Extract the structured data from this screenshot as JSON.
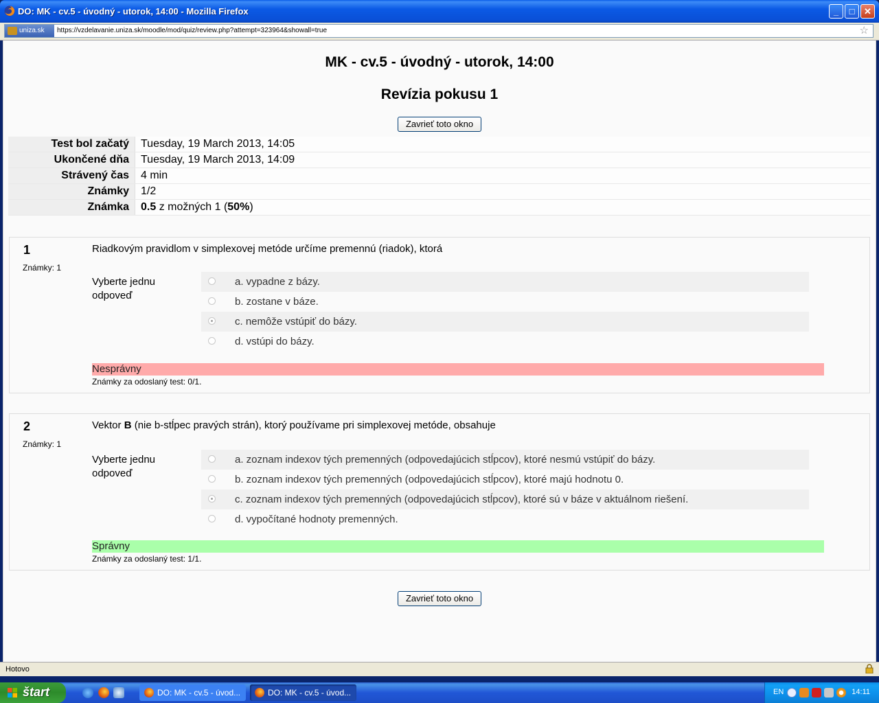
{
  "window": {
    "title": "DO: MK - cv.5 - úvodný - utorok, 14:00 - Mozilla Firefox"
  },
  "addressbar": {
    "site_identity": "uniza.sk",
    "url": "https://vzdelavanie.uniza.sk/moodle/mod/quiz/review.php?attempt=323964&showall=true"
  },
  "page": {
    "title": "MK - cv.5 - úvodný - utorok, 14:00",
    "subtitle": "Revízia pokusu 1",
    "close_button": "Zavrieť toto okno"
  },
  "summary": {
    "rows": [
      {
        "label": "Test bol začatý",
        "value": "Tuesday, 19 March 2013, 14:05"
      },
      {
        "label": "Ukončené dňa",
        "value": "Tuesday, 19 March 2013, 14:09"
      },
      {
        "label": "Strávený čas",
        "value": "4 min"
      },
      {
        "label": "Známky",
        "value": "1/2"
      },
      {
        "label": "Známka",
        "value_bold": "0.5",
        "value_mid": " z možných 1 (",
        "value_pct": "50%",
        "value_end": ")"
      }
    ]
  },
  "questions": [
    {
      "number": "1",
      "marks": "Známky: 1",
      "text": "Riadkovým pravidlom v simplexovej metóde určíme premennú (riadok), ktorá",
      "prompt": "Vyberte jednu odpoveď",
      "answers": [
        {
          "label": "a. vypadne z bázy.",
          "checked": false
        },
        {
          "label": "b. zostane v báze.",
          "checked": false
        },
        {
          "label": "c. nemôže vstúpiť do bázy.",
          "checked": true
        },
        {
          "label": "d. vstúpi do bázy.",
          "checked": false
        }
      ],
      "result": "Nesprávny",
      "result_marks": "Známky za odoslaný test: 0/1."
    },
    {
      "number": "2",
      "marks": "Známky: 1",
      "text_pre": "Vektor ",
      "text_bold": "B",
      "text_post": " (nie b-stĺpec pravých strán), ktorý používame pri simplexovej metóde, obsahuje",
      "prompt": "Vyberte jednu odpoveď",
      "answers": [
        {
          "label": "a. zoznam indexov tých premenných (odpovedajúcich stĺpcov), ktoré nesmú vstúpiť do bázy.",
          "checked": false
        },
        {
          "label": "b. zoznam indexov tých premenných (odpovedajúcich stĺpcov), ktoré majú hodnotu 0.",
          "checked": false
        },
        {
          "label": "c. zoznam indexov tých premenných (odpovedajúcich stĺpcov), ktoré sú v báze v aktuálnom riešení.",
          "checked": true
        },
        {
          "label": "d. vypočítané hodnoty premenných.",
          "checked": false
        }
      ],
      "result": "Správny",
      "result_marks": "Známky za odoslaný test: 1/1."
    }
  ],
  "statusbar": {
    "text": "Hotovo"
  },
  "taskbar": {
    "start_label": "štart",
    "tasks": [
      "DO: MK - cv.5 - úvod...",
      "DO: MK - cv.5 - úvod..."
    ],
    "language": "EN",
    "clock": "14:11"
  },
  "colors": {
    "wrong": "#ffaaaa",
    "right": "#aaffaa",
    "titlebar": "#0a5de8"
  }
}
